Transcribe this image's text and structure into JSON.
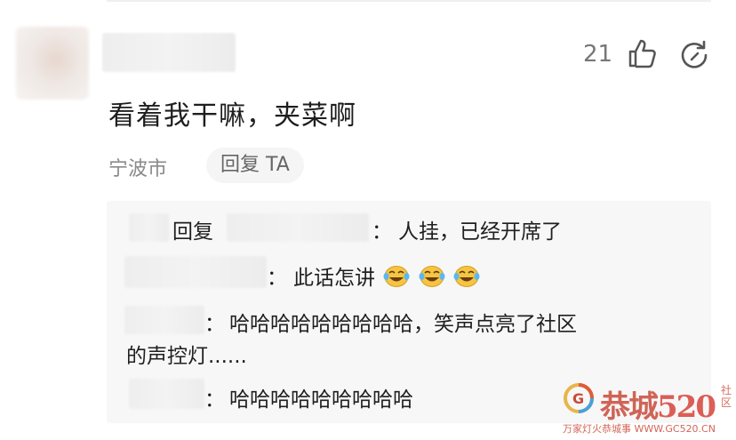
{
  "comment": {
    "like_count": "21",
    "text": "看着我干嘛，夹菜啊",
    "location": "宁波市",
    "reply_button": "回复 TA"
  },
  "replies": [
    {
      "reply_word": "回复",
      "colon": "：",
      "text": "人挂，已经开席了"
    },
    {
      "colon": "：",
      "text": "此话怎讲"
    },
    {
      "colon": "：",
      "text_line1": "哈哈哈哈哈哈哈哈哈，笑声点亮了社区",
      "text_line2": "的声控灯......"
    },
    {
      "colon": "：",
      "text": "哈哈哈哈哈哈哈哈哈"
    }
  ],
  "emoji_name": "laugh-cry-emoji",
  "watermark": {
    "main": "恭城",
    "num": "520",
    "side": "社区",
    "sub": "万家灯火恭城事 WWW.GC520.CN"
  },
  "colors": {
    "accent": "#c94b3a",
    "panel": "#f7f7f7",
    "muted": "#8a8a8a"
  }
}
